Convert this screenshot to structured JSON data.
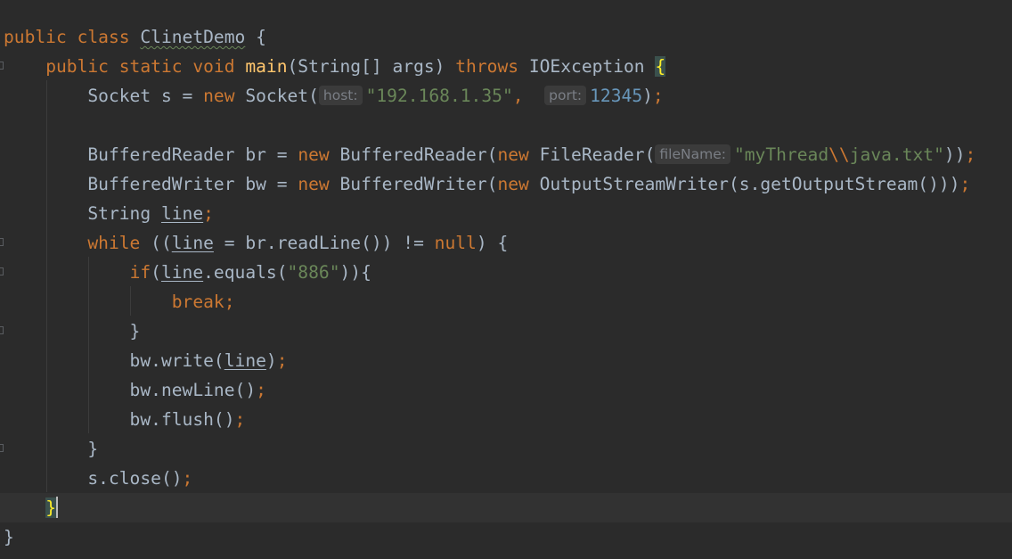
{
  "editor": {
    "lines": [
      {
        "parts": [
          {
            "t": "public class ",
            "c": "kw"
          },
          {
            "t": "ClinetDemo",
            "c": "typo"
          },
          {
            "t": " {",
            "c": ""
          }
        ]
      },
      {
        "parts": [
          {
            "t": "    ",
            "c": ""
          },
          {
            "t": "public static void ",
            "c": "kw"
          },
          {
            "t": "main",
            "c": "fn"
          },
          {
            "t": "(String[] args) ",
            "c": ""
          },
          {
            "t": "throws ",
            "c": "kw"
          },
          {
            "t": "IOException ",
            "c": ""
          },
          {
            "t": "{",
            "c": "brace-hl"
          }
        ]
      },
      {
        "parts": [
          {
            "t": "        Socket s = ",
            "c": ""
          },
          {
            "t": "new ",
            "c": "kw"
          },
          {
            "t": "Socket(",
            "c": ""
          },
          {
            "t": "host:",
            "c": "hint"
          },
          {
            "t": "\"192.168.1.35\"",
            "c": "str"
          },
          {
            "t": ",  ",
            "c": "punc"
          },
          {
            "t": "port:",
            "c": "hint"
          },
          {
            "t": "12345",
            "c": "num"
          },
          {
            "t": ")",
            "c": ""
          },
          {
            "t": ";",
            "c": "punc"
          }
        ]
      },
      {
        "parts": []
      },
      {
        "parts": [
          {
            "t": "        BufferedReader br = ",
            "c": ""
          },
          {
            "t": "new ",
            "c": "kw"
          },
          {
            "t": "BufferedReader(",
            "c": ""
          },
          {
            "t": "new ",
            "c": "kw"
          },
          {
            "t": "FileReader(",
            "c": ""
          },
          {
            "t": "fileName:",
            "c": "hint"
          },
          {
            "t": "\"myThread",
            "c": "str"
          },
          {
            "t": "\\\\",
            "c": "esc"
          },
          {
            "t": "java.txt\"",
            "c": "str"
          },
          {
            "t": "))",
            "c": ""
          },
          {
            "t": ";",
            "c": "punc"
          }
        ]
      },
      {
        "parts": [
          {
            "t": "        BufferedWriter bw = ",
            "c": ""
          },
          {
            "t": "new ",
            "c": "kw"
          },
          {
            "t": "BufferedWriter(",
            "c": ""
          },
          {
            "t": "new ",
            "c": "kw"
          },
          {
            "t": "OutputStreamWriter(s.getOutputStream()))",
            "c": ""
          },
          {
            "t": ";",
            "c": "punc"
          }
        ]
      },
      {
        "parts": [
          {
            "t": "        String ",
            "c": ""
          },
          {
            "t": "line",
            "c": "var-u"
          },
          {
            "t": ";",
            "c": "punc"
          }
        ]
      },
      {
        "parts": [
          {
            "t": "        ",
            "c": ""
          },
          {
            "t": "while ",
            "c": "kw"
          },
          {
            "t": "((",
            "c": ""
          },
          {
            "t": "line",
            "c": "var-u"
          },
          {
            "t": " = br.readLine()) != ",
            "c": ""
          },
          {
            "t": "null",
            "c": "kw"
          },
          {
            "t": ") {",
            "c": ""
          }
        ]
      },
      {
        "parts": [
          {
            "t": "            ",
            "c": ""
          },
          {
            "t": "if",
            "c": "kw"
          },
          {
            "t": "(",
            "c": ""
          },
          {
            "t": "line",
            "c": "var-u"
          },
          {
            "t": ".equals(",
            "c": ""
          },
          {
            "t": "\"886\"",
            "c": "str"
          },
          {
            "t": ")){",
            "c": ""
          }
        ]
      },
      {
        "parts": [
          {
            "t": "                ",
            "c": ""
          },
          {
            "t": "break",
            "c": "kw"
          },
          {
            "t": ";",
            "c": "punc"
          }
        ]
      },
      {
        "parts": [
          {
            "t": "            }",
            "c": ""
          }
        ]
      },
      {
        "parts": [
          {
            "t": "            bw.write(",
            "c": ""
          },
          {
            "t": "line",
            "c": "var-u"
          },
          {
            "t": ")",
            "c": ""
          },
          {
            "t": ";",
            "c": "punc"
          }
        ]
      },
      {
        "parts": [
          {
            "t": "            bw.newLine()",
            "c": ""
          },
          {
            "t": ";",
            "c": "punc"
          }
        ]
      },
      {
        "parts": [
          {
            "t": "            bw.flush()",
            "c": ""
          },
          {
            "t": ";",
            "c": "punc"
          }
        ]
      },
      {
        "parts": [
          {
            "t": "        }",
            "c": ""
          }
        ]
      },
      {
        "parts": [
          {
            "t": "        s.close()",
            "c": ""
          },
          {
            "t": ";",
            "c": "punc"
          }
        ]
      },
      {
        "parts": [
          {
            "t": "    ",
            "c": ""
          },
          {
            "t": "}",
            "c": "brace-hl"
          }
        ],
        "current": true,
        "caret": true
      },
      {
        "parts": [
          {
            "t": "}",
            "c": ""
          }
        ]
      }
    ]
  },
  "colors": {
    "background": "#2b2b2b",
    "current_line": "#323232",
    "default_text": "#a9b7c6",
    "keyword": "#cc7832",
    "method": "#ffc66d",
    "string": "#6a8759",
    "number": "#6897bb",
    "hint_text": "#7a7e85",
    "hint_bg": "#3b3b3b",
    "brace_match_bg": "#3b514d",
    "brace_match_fg": "#ffef28"
  }
}
